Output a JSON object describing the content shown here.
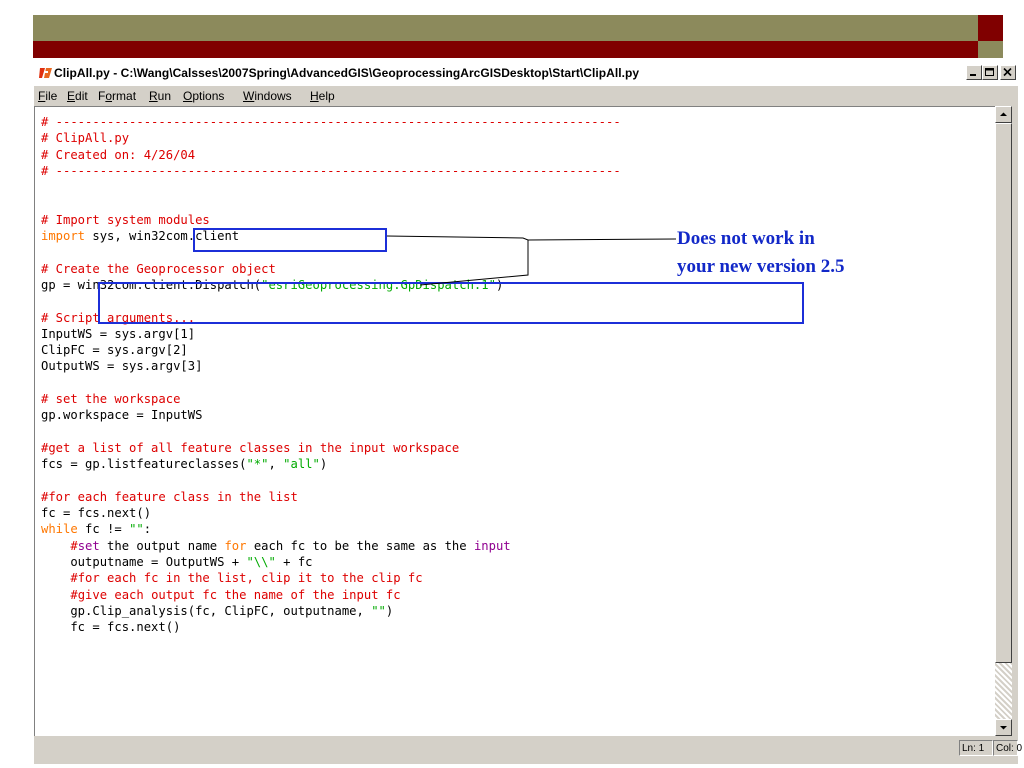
{
  "window": {
    "title": "ClipAll.py - C:\\Wang\\Calsses\\2007Spring\\AdvancedGIS\\GeoprocessingArcGISDesktop\\Start\\ClipAll.py",
    "icon": "python-idle-icon",
    "buttons": {
      "minimize": "minimize-icon",
      "maximize": "maximize-icon",
      "close": "close-icon"
    }
  },
  "menu": {
    "file": "File",
    "edit": "Edit",
    "format": "Format",
    "run": "Run",
    "options": "Options",
    "windows": "Windows",
    "help": "Help"
  },
  "code": {
    "lines": [
      [
        [
          "c",
          "# -----------------------------------------------------------------------------"
        ]
      ],
      [
        [
          "c",
          "# ClipAll.py"
        ]
      ],
      [
        [
          "c",
          "# Created on: 4/26/04"
        ]
      ],
      [
        [
          "c",
          "# -----------------------------------------------------------------------------"
        ]
      ],
      [],
      [],
      [
        [
          "c",
          "# Import system modules"
        ]
      ],
      [
        [
          "k",
          "import"
        ],
        [
          "t",
          " sys, win32com.client"
        ]
      ],
      [],
      [
        [
          "c",
          "# Create the Geoprocessor object"
        ]
      ],
      [
        [
          "t",
          "gp = win32com.client.Dispatch("
        ],
        [
          "s",
          "\"esriGeoprocessing.GpDispatch.1\""
        ],
        [
          "t",
          ")"
        ]
      ],
      [],
      [
        [
          "c",
          "# Script arguments..."
        ]
      ],
      [
        [
          "t",
          "InputWS = sys.argv[1]"
        ]
      ],
      [
        [
          "t",
          "ClipFC = sys.argv[2]"
        ]
      ],
      [
        [
          "t",
          "OutputWS = sys.argv[3]"
        ]
      ],
      [],
      [
        [
          "c",
          "# set the workspace"
        ]
      ],
      [
        [
          "t",
          "gp.workspace = InputWS"
        ]
      ],
      [],
      [
        [
          "c",
          "#get a list of all feature classes in the input workspace"
        ]
      ],
      [
        [
          "t",
          "fcs = gp.listfeatureclasses("
        ],
        [
          "s",
          "\"*\""
        ],
        [
          "t",
          ", "
        ],
        [
          "s",
          "\"all\""
        ],
        [
          "t",
          ")"
        ]
      ],
      [],
      [
        [
          "c",
          "#for each feature class in the list"
        ]
      ],
      [
        [
          "t",
          "fc = fcs.next()"
        ]
      ],
      [
        [
          "k",
          "while"
        ],
        [
          "t",
          " fc != "
        ],
        [
          "s",
          "\"\""
        ],
        [
          "t",
          ":"
        ]
      ],
      [
        [
          "t",
          "    "
        ],
        [
          "c",
          "#"
        ],
        [
          "b",
          "set"
        ],
        [
          "t",
          " the output name "
        ],
        [
          "k",
          "for"
        ],
        [
          "t",
          " each fc to be the same as the "
        ],
        [
          "b",
          "input"
        ]
      ],
      [
        [
          "t",
          "    outputname = OutputWS + "
        ],
        [
          "s",
          "\"\\\\\""
        ],
        [
          "t",
          " + fc"
        ]
      ],
      [
        [
          "t",
          "    "
        ],
        [
          "c",
          "#for each fc in the list, clip it to the clip fc"
        ]
      ],
      [
        [
          "t",
          "    "
        ],
        [
          "c",
          "#give each output fc the name of the input fc"
        ]
      ],
      [
        [
          "t",
          "    gp.Clip_analysis(fc, ClipFC, outputname, "
        ],
        [
          "s",
          "\"\""
        ],
        [
          "t",
          ")"
        ]
      ],
      [
        [
          "t",
          "    fc = fcs.next()"
        ]
      ]
    ]
  },
  "annotation": {
    "line1": "Does not work in",
    "line2": "your new version 2.5"
  },
  "status": {
    "line": "Ln: 1",
    "col": "Col: 0"
  },
  "colors": {
    "comment": "#dd0000",
    "keyword": "#ff7700",
    "string": "#00aa00",
    "builtin": "#900090",
    "highlight": "#1c2fd8",
    "annotation": "#1228c8",
    "slide_olive": "#8c8a5c",
    "slide_maroon": "#800000"
  }
}
